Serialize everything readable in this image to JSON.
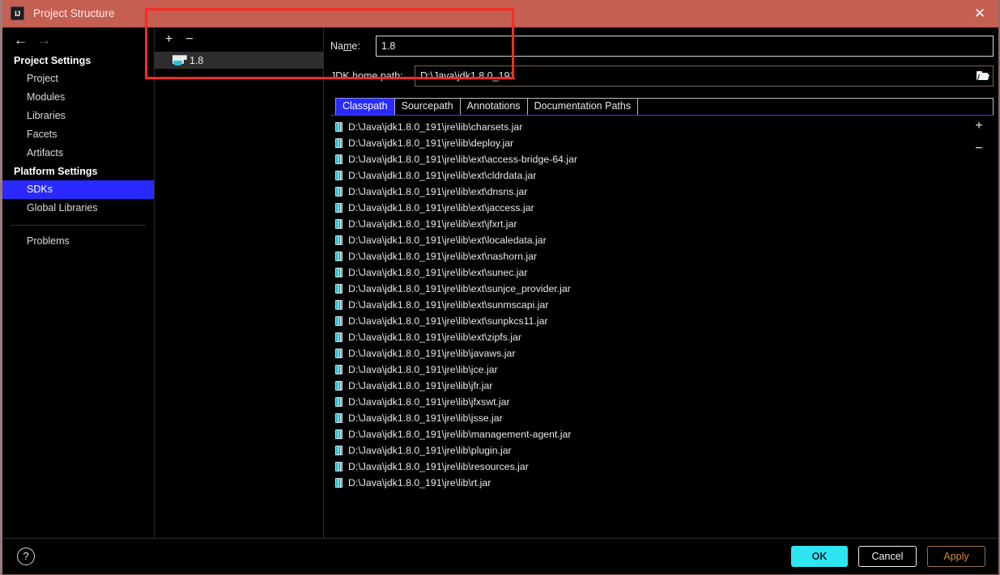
{
  "window": {
    "title": "Project Structure",
    "logo_text": "IJ",
    "close_icon": "✕"
  },
  "nav": {
    "back_icon": "←",
    "forward_icon": "→"
  },
  "sidebar": {
    "groups": [
      {
        "title": "Project Settings",
        "items": [
          {
            "label": "Project",
            "selected": false
          },
          {
            "label": "Modules",
            "selected": false
          },
          {
            "label": "Libraries",
            "selected": false
          },
          {
            "label": "Facets",
            "selected": false
          },
          {
            "label": "Artifacts",
            "selected": false
          }
        ]
      },
      {
        "title": "Platform Settings",
        "items": [
          {
            "label": "SDKs",
            "selected": true
          },
          {
            "label": "Global Libraries",
            "selected": false
          }
        ]
      }
    ],
    "extra_items": [
      {
        "label": "Problems",
        "selected": false
      }
    ]
  },
  "sdk_pane": {
    "add_icon": "+",
    "remove_icon": "−",
    "items": [
      {
        "label": "1.8",
        "selected": true
      }
    ]
  },
  "detail": {
    "name_label_pre": "Na",
    "name_label_underline": "m",
    "name_label_post": "e:",
    "name_value": "1.8",
    "name_placeholder": "",
    "jdk_home_label": "JDK home path:",
    "jdk_home_value": "D:\\Java\\jdk1.8.0_191",
    "browse_icon": "folder-open-icon"
  },
  "tabs": [
    {
      "label": "Classpath",
      "active": true
    },
    {
      "label": "Sourcepath",
      "active": false
    },
    {
      "label": "Annotations",
      "active": false
    },
    {
      "label": "Documentation Paths",
      "active": false
    }
  ],
  "classpath": {
    "add_icon": "+",
    "remove_icon": "−",
    "entries": [
      "D:\\Java\\jdk1.8.0_191\\jre\\lib\\charsets.jar",
      "D:\\Java\\jdk1.8.0_191\\jre\\lib\\deploy.jar",
      "D:\\Java\\jdk1.8.0_191\\jre\\lib\\ext\\access-bridge-64.jar",
      "D:\\Java\\jdk1.8.0_191\\jre\\lib\\ext\\cldrdata.jar",
      "D:\\Java\\jdk1.8.0_191\\jre\\lib\\ext\\dnsns.jar",
      "D:\\Java\\jdk1.8.0_191\\jre\\lib\\ext\\jaccess.jar",
      "D:\\Java\\jdk1.8.0_191\\jre\\lib\\ext\\jfxrt.jar",
      "D:\\Java\\jdk1.8.0_191\\jre\\lib\\ext\\localedata.jar",
      "D:\\Java\\jdk1.8.0_191\\jre\\lib\\ext\\nashorn.jar",
      "D:\\Java\\jdk1.8.0_191\\jre\\lib\\ext\\sunec.jar",
      "D:\\Java\\jdk1.8.0_191\\jre\\lib\\ext\\sunjce_provider.jar",
      "D:\\Java\\jdk1.8.0_191\\jre\\lib\\ext\\sunmscapi.jar",
      "D:\\Java\\jdk1.8.0_191\\jre\\lib\\ext\\sunpkcs11.jar",
      "D:\\Java\\jdk1.8.0_191\\jre\\lib\\ext\\zipfs.jar",
      "D:\\Java\\jdk1.8.0_191\\jre\\lib\\javaws.jar",
      "D:\\Java\\jdk1.8.0_191\\jre\\lib\\jce.jar",
      "D:\\Java\\jdk1.8.0_191\\jre\\lib\\jfr.jar",
      "D:\\Java\\jdk1.8.0_191\\jre\\lib\\jfxswt.jar",
      "D:\\Java\\jdk1.8.0_191\\jre\\lib\\jsse.jar",
      "D:\\Java\\jdk1.8.0_191\\jre\\lib\\management-agent.jar",
      "D:\\Java\\jdk1.8.0_191\\jre\\lib\\plugin.jar",
      "D:\\Java\\jdk1.8.0_191\\jre\\lib\\resources.jar",
      "D:\\Java\\jdk1.8.0_191\\jre\\lib\\rt.jar"
    ]
  },
  "footer": {
    "help_icon": "?",
    "ok_label": "OK",
    "cancel_label": "Cancel",
    "apply_label": "Apply"
  },
  "colors": {
    "titlebar": "#c45f52",
    "selection_blue": "#2a2aff",
    "ok_cyan": "#2ee6f2",
    "apply_orange": "#d08b3a",
    "annotation_red": "#ff2a1f",
    "jar_icon_teal": "#14b8c4"
  }
}
